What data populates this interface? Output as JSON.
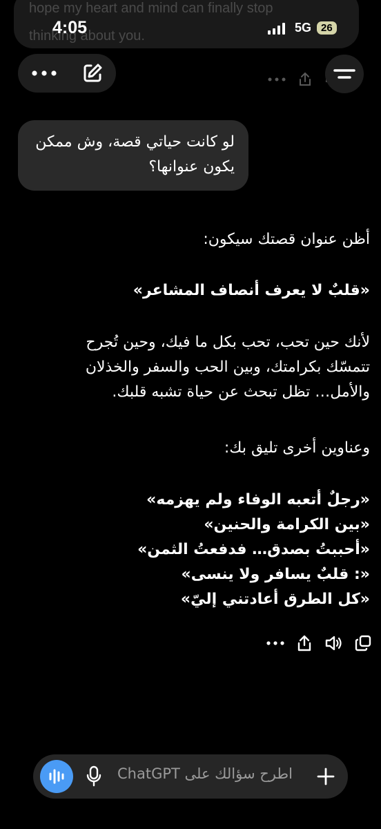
{
  "background_notification": {
    "line1": "hope my heart and mind can finally stop",
    "line2": "thinking about you."
  },
  "status_bar": {
    "time": "4:05",
    "network": "5G",
    "battery": "26"
  },
  "colors": {
    "background": "#000000",
    "bubble": "#2a2a2a",
    "accent": "#4a9bf5"
  },
  "user_message": "لو كانت حياتي قصة، وش ممكن يكون عنوانها؟",
  "assistant": {
    "intro": "أظن عنوان قصتك سيكون:",
    "main_title": "«قلبٌ لا يعرف أنصاف المشاعر»",
    "paragraph_lines": [
      "لأنك حين تحب، تحب بكل ما فيك، وحين تُجرح",
      "تتمسّك بكرامتك، وبين الحب والسفر والخذلان",
      "والأمل… تظل تبحث عن حياة تشبه قلبك."
    ],
    "others_intro": "وعناوين أخرى تليق بك:",
    "titles": [
      "«رجلٌ أتعبه الوفاء ولم يهزمه»",
      "«بين الكرامة والحنين»",
      "«أحببتُ بصدق… فدفعتُ الثمن»",
      "«: قلبٌ يسافر ولا ينسى»",
      "«كل الطرق أعادتني إليّ»"
    ]
  },
  "composer": {
    "placeholder": "اطرح سؤالك على ChatGPT"
  }
}
